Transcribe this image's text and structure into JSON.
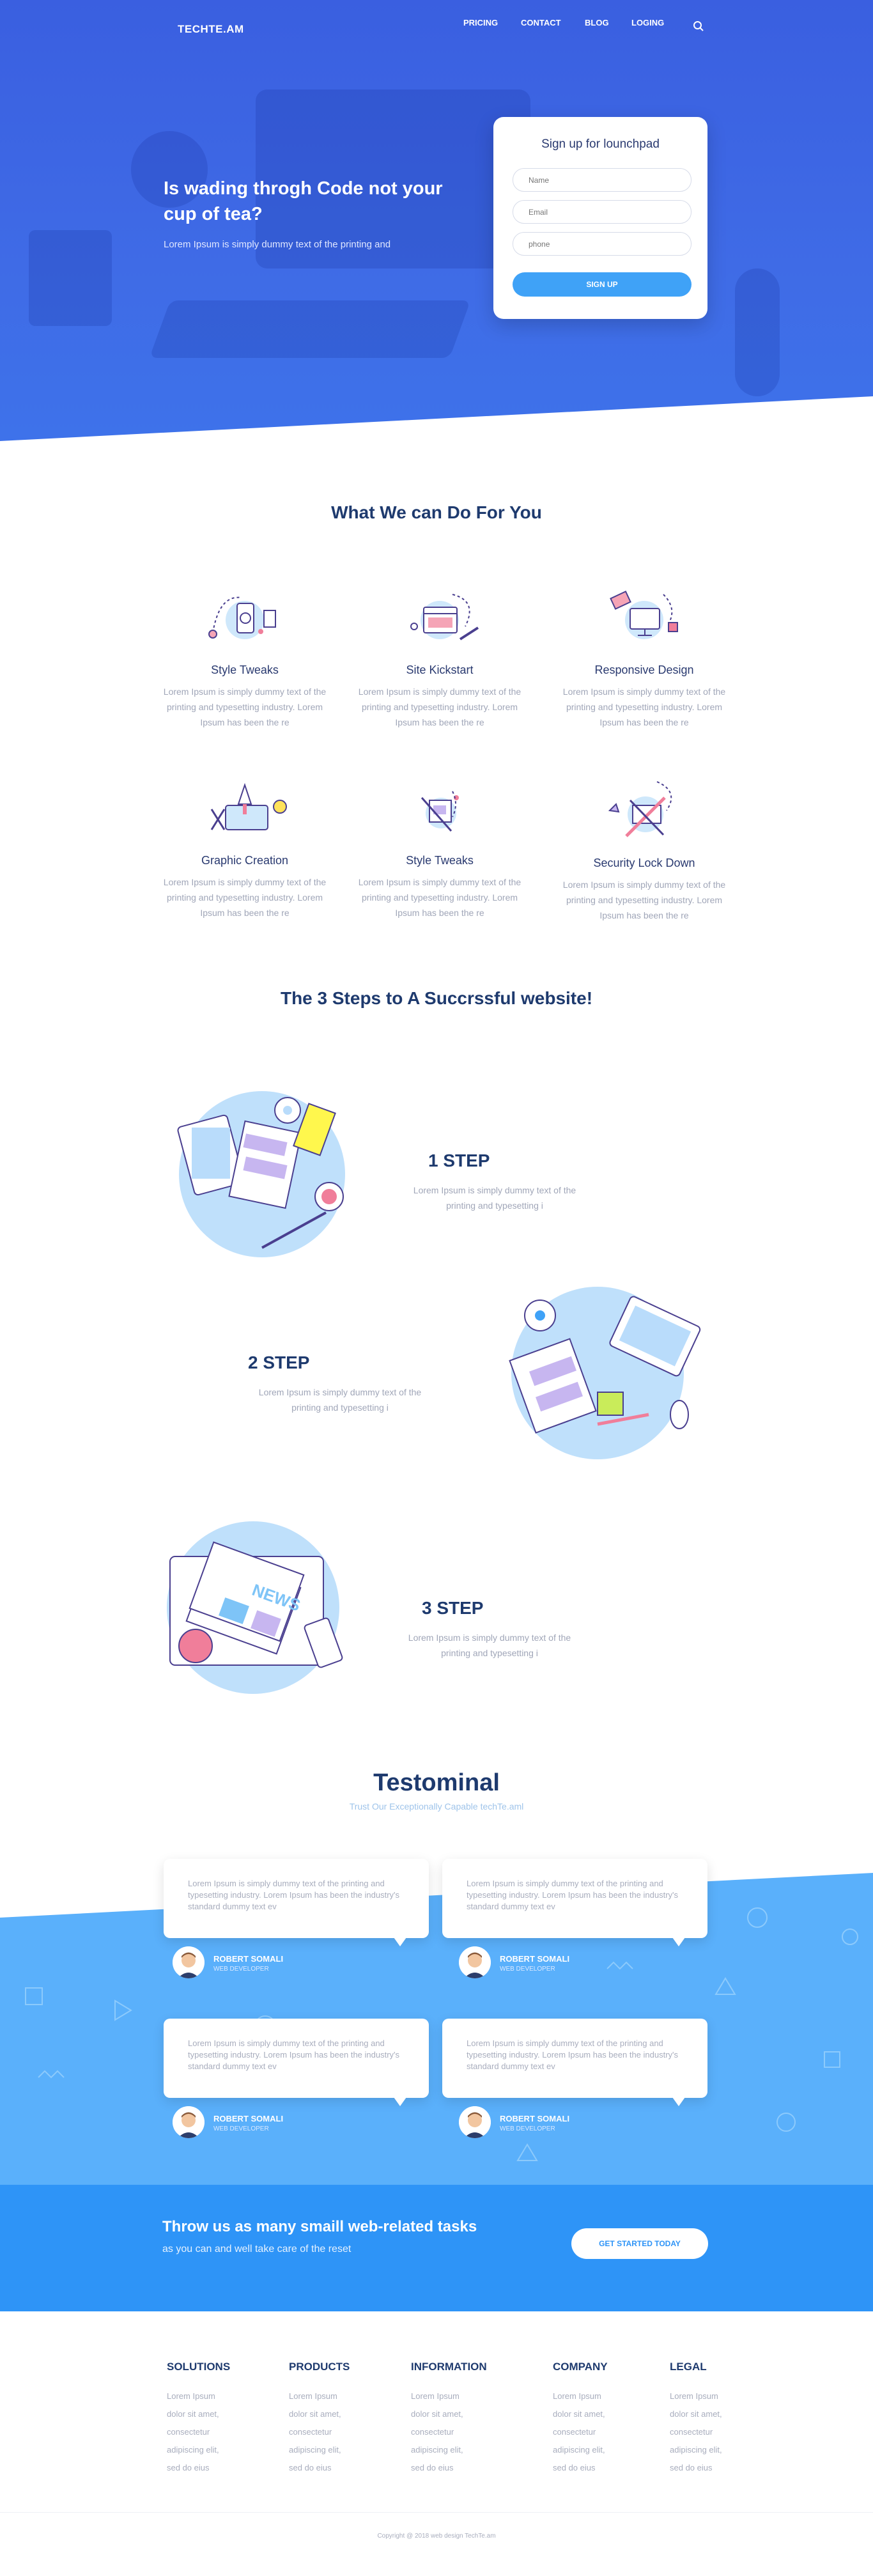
{
  "header": {
    "logo": "TECHTE.AM",
    "nav": [
      "PRICING",
      "CONTACT",
      "BLOG",
      "LOGING"
    ],
    "search_icon": "search-icon"
  },
  "hero": {
    "title": "Is wading throgh Code not your cup of tea?",
    "subtitle": "Lorem Ipsum is simply dummy text of the printing and",
    "signup": {
      "title": "Sign up for lounchpad",
      "name_placeholder": "Name",
      "email_placeholder": "Email",
      "phone_placeholder": "phone",
      "button": "SIGN UP"
    },
    "colors": {
      "primary": "#3a5fe0",
      "accent": "#3fa2f7"
    }
  },
  "services": {
    "title": "What We can Do For You",
    "items": [
      {
        "title": "Style Tweaks",
        "text": "Lorem Ipsum is simply dummy text of the printing and typesetting industry. Lorem Ipsum has been the re",
        "icon": "mobile-icon"
      },
      {
        "title": "Site Kickstart",
        "text": "Lorem Ipsum is simply dummy text of the printing and typesetting industry. Lorem Ipsum has been the re",
        "icon": "browser-icon"
      },
      {
        "title": "Responsive Design",
        "text": "Lorem Ipsum is simply dummy text of the printing and typesetting industry. Lorem Ipsum has been the re",
        "icon": "monitor-icon"
      },
      {
        "title": "Graphic Creation",
        "text": "Lorem Ipsum is simply dummy text of the printing and typesetting industry. Lorem Ipsum has been the re",
        "icon": "rocket-icon"
      },
      {
        "title": "Style Tweaks",
        "text": "Lorem Ipsum is simply dummy text of the printing and typesetting industry. Lorem Ipsum has been the re",
        "icon": "pen-tablet-icon"
      },
      {
        "title": "Security Lock Down",
        "text": "Lorem Ipsum is simply dummy text of the printing and typesetting industry. Lorem Ipsum has been the re",
        "icon": "tools-icon"
      }
    ]
  },
  "steps": {
    "title": "The 3 Steps to A Succrssful website!",
    "items": [
      {
        "title": "1 STEP",
        "text": "Lorem Ipsum is simply dummy text of the printing and typesetting i"
      },
      {
        "title": "2 STEP",
        "text": "Lorem Ipsum is simply dummy text of the printing and typesetting i"
      },
      {
        "title": "3 STEP",
        "text": "Lorem Ipsum is simply dummy text of the printing and typesetting i"
      }
    ]
  },
  "testimonials": {
    "title": "Testominal",
    "subtitle": "Trust Our Exceptionally Capable techTe.aml",
    "items": [
      {
        "text": "Lorem Ipsum is simply dummy text of the printing and typesetting industry. Lorem Ipsum has been the industry's standard dummy text ev",
        "name": "ROBERT SOMALI",
        "role": "WEB DEVELOPER"
      },
      {
        "text": "Lorem Ipsum is simply dummy text of the printing and typesetting industry. Lorem Ipsum has been the industry's standard dummy text ev",
        "name": "ROBERT SOMALI",
        "role": "WEB DEVELOPER"
      },
      {
        "text": "Lorem Ipsum is simply dummy text of the printing and typesetting industry. Lorem Ipsum has been the industry's standard dummy text ev",
        "name": "ROBERT SOMALI",
        "role": "WEB DEVELOPER"
      },
      {
        "text": "Lorem Ipsum is simply dummy text of the printing and typesetting industry. Lorem Ipsum has been the industry's standard dummy text ev",
        "name": "ROBERT SOMALI",
        "role": "WEB DEVELOPER"
      }
    ]
  },
  "cta": {
    "title": "Throw us as many smaill web-related tasks",
    "subtitle": "as you can and well take care of the reset",
    "button": "GET STARTED TODAY"
  },
  "footer": {
    "columns": [
      {
        "title": "SOLUTIONS",
        "items": [
          "Lorem Ipsum",
          "dolor sit amet,",
          "consectetur",
          "adipiscing elit,",
          "sed do eius"
        ]
      },
      {
        "title": "PRODUCTS",
        "items": [
          "Lorem Ipsum",
          "dolor sit amet,",
          "consectetur",
          "adipiscing elit,",
          "sed do eius"
        ]
      },
      {
        "title": "INFORMATION",
        "items": [
          "Lorem Ipsum",
          "dolor sit amet,",
          "consectetur",
          "adipiscing elit,",
          "sed do eius"
        ]
      },
      {
        "title": "COMPANY",
        "items": [
          "Lorem Ipsum",
          "dolor sit amet,",
          "consectetur",
          "adipiscing elit,",
          "sed do eius"
        ]
      },
      {
        "title": "LEGAL",
        "items": [
          "Lorem Ipsum",
          "dolor sit amet,",
          "consectetur",
          "adipiscing elit,",
          "sed do eius"
        ]
      }
    ],
    "copyright": "Copyright @ 2018 web design TechTe.am"
  }
}
